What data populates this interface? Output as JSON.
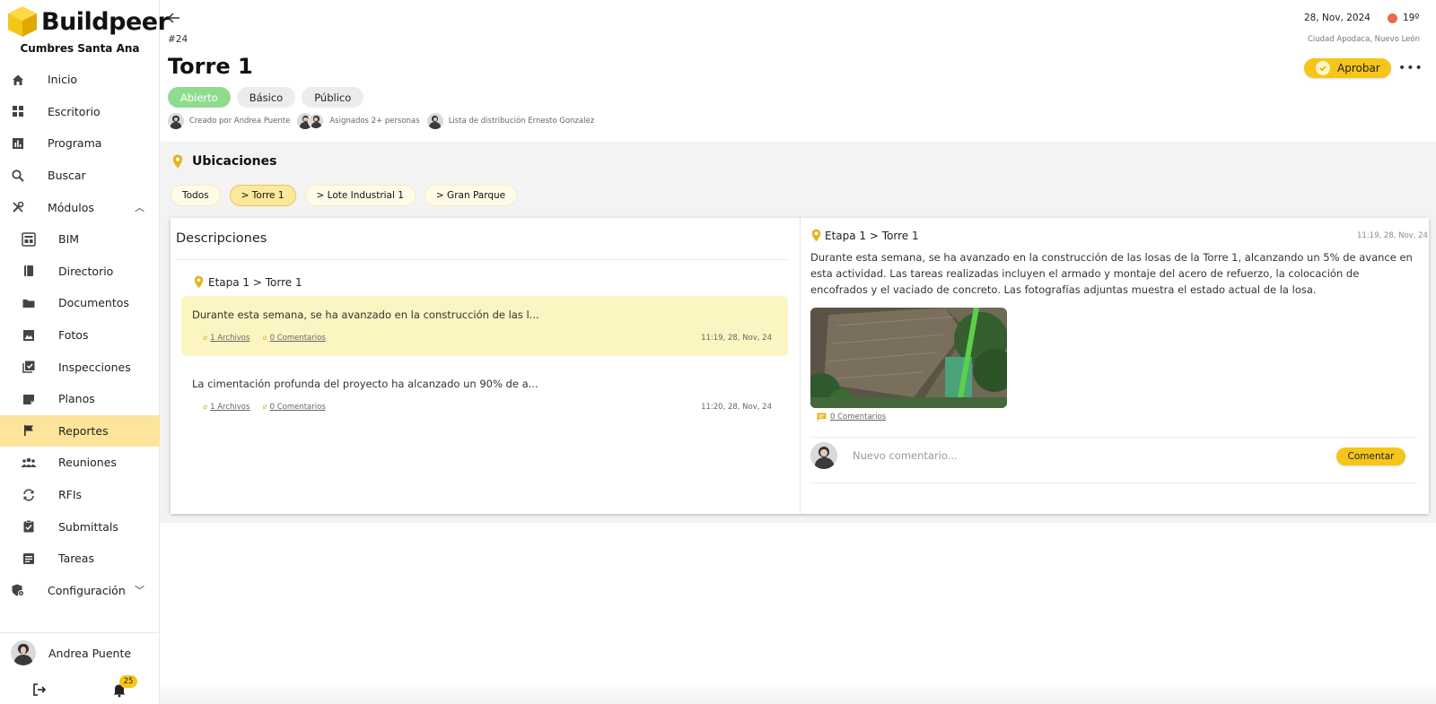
{
  "brand": {
    "name": "Buildpeer",
    "project": "Cumbres Santa Ana",
    "accent": "#f5c518",
    "highlight": "#fce49a"
  },
  "sidebar": {
    "items": [
      {
        "label": "Inicio",
        "icon": "home-icon"
      },
      {
        "label": "Escritorio",
        "icon": "dashboard-icon"
      },
      {
        "label": "Programa",
        "icon": "chart-icon"
      },
      {
        "label": "Buscar",
        "icon": "search-icon"
      },
      {
        "label": "Módulos",
        "icon": "tools-icon"
      }
    ],
    "modules": [
      {
        "label": "BIM",
        "icon": "bim-icon"
      },
      {
        "label": "Directorio",
        "icon": "book-icon"
      },
      {
        "label": "Documentos",
        "icon": "folder-icon"
      },
      {
        "label": "Fotos",
        "icon": "image-icon"
      },
      {
        "label": "Inspecciones",
        "icon": "checklist-icon"
      },
      {
        "label": "Planos",
        "icon": "note-icon"
      },
      {
        "label": "Reportes",
        "icon": "flag-icon",
        "active": true
      },
      {
        "label": "Reuniones",
        "icon": "people-icon"
      },
      {
        "label": "RFIs",
        "icon": "sync-icon"
      },
      {
        "label": "Submittals",
        "icon": "clipboard-check-icon"
      },
      {
        "label": "Tareas",
        "icon": "task-icon"
      }
    ],
    "config": {
      "label": "Configuración",
      "icon": "settings-shield-icon"
    },
    "user": {
      "name": "Andrea Puente"
    },
    "notifications": "25"
  },
  "header": {
    "ticket": "#24",
    "title": "Torre 1",
    "chips": [
      "Abierto",
      "Básico",
      "Público"
    ],
    "created_by": "Creado por Andrea Puente",
    "assigned": "Asignados 2+ personas",
    "distribution": "Lista de distribución Ernesto Gonzalez",
    "date": "28, Nov, 2024",
    "temperature": "19º",
    "city": "Ciudad Apodaca, Nuevo León",
    "approve_label": "Aprobar",
    "more_label": "•••"
  },
  "locations": {
    "title": "Ubicaciones",
    "filters": [
      "Todos",
      "> Torre 1",
      "> Lote Industrial 1",
      "> Gran Parque"
    ],
    "active_filter": 1
  },
  "descriptions": {
    "title": "Descripciones",
    "group": "Etapa 1 > Torre 1",
    "entries": [
      {
        "text": "Durante esta semana, se ha avanzado en la construcción de las l...",
        "files": "1 Archivos",
        "comments": "0 Comentarios",
        "time": "11:19, 28, Nov, 24"
      },
      {
        "text": "La cimentación profunda del proyecto ha alcanzado un 90% de a...",
        "files": "1 Archivos",
        "comments": "0 Comentarios",
        "time": "11:20, 28, Nov, 24"
      }
    ]
  },
  "detail": {
    "location": "Etapa 1 > Torre 1",
    "time": "11:19, 28, Nov, 24",
    "body": "Durante esta semana, se ha avanzado en la construcción de las losas de la Torre 1, alcanzando un 5% de avance en esta actividad. Las tareas realizadas incluyen el armado y montaje del acero de refuerzo, la colocación de encofrados y el vaciado de concreto. Las fotografías adjuntas muestra el estado actual de la losa.",
    "photo_comments": "0 Comentarios",
    "comment_placeholder": "Nuevo comentario...",
    "comment_button": "Comentar"
  }
}
